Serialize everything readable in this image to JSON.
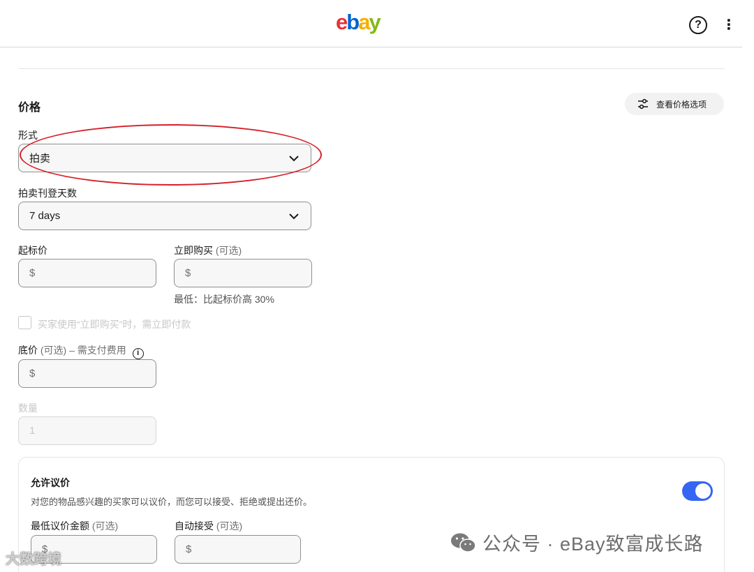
{
  "header": {
    "logo": {
      "e": "e",
      "b": "b",
      "a": "a",
      "y": "y"
    },
    "help_label": "?",
    "more_label": "⋮"
  },
  "pricing": {
    "title": "价格",
    "view_options_label": "查看价格选项",
    "format": {
      "label": "形式",
      "value": "拍卖"
    },
    "duration": {
      "label": "拍卖刊登天数",
      "value": "7 days"
    },
    "starting_price": {
      "label": "起标价",
      "currency": "$"
    },
    "buy_it_now": {
      "label": "立即购买",
      "optional": "(可选)",
      "currency": "$",
      "hint": "最低：比起标价高 30%"
    },
    "immediate_payment": {
      "label": "买家使用“立即购买”时，需立即付款",
      "checked": false
    },
    "reserve_price": {
      "label": "底价",
      "optional": "(可选)",
      "suffix": "– 需支付费用",
      "info_label": "i",
      "currency": "$"
    },
    "quantity": {
      "label": "数量",
      "value": "1"
    }
  },
  "best_offer": {
    "title": "允许议价",
    "description": "对您的物品感兴趣的买家可以议价，而您可以接受、拒绝或提出还价。",
    "enabled": true,
    "min_offer": {
      "label": "最低议价金额",
      "optional": "(可选)",
      "currency": "$"
    },
    "auto_accept": {
      "label": "自动接受",
      "optional": "(可选)",
      "currency": "$"
    }
  },
  "watermarks": {
    "main": "公众号 · eBay致富成长路",
    "corner": "大数跨境"
  },
  "colors": {
    "accent": "#3665f3",
    "annotation": "#d62028",
    "logo_e": "#e53238",
    "logo_b": "#0064d2",
    "logo_a": "#f5af02",
    "logo_y": "#86b817"
  },
  "icons": {
    "help": "question-circle-icon",
    "more": "more-vertical-icon",
    "options": "sliders-icon",
    "dropdown": "chevron-down-icon",
    "info": "info-icon",
    "watermark": "wechat-icon"
  }
}
